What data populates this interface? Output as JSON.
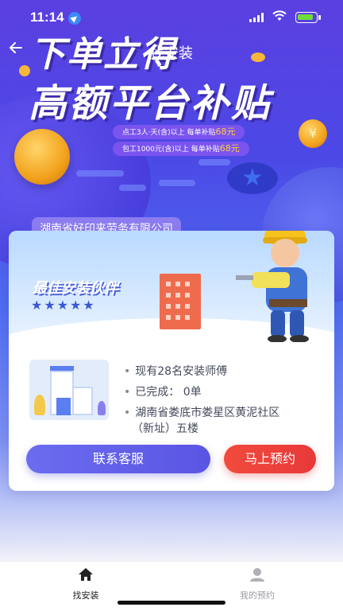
{
  "status_bar": {
    "time": "11:14"
  },
  "nav": {
    "title": "找安装"
  },
  "hero": {
    "headline_line1": "下单立得",
    "headline_line2": "高额平台补贴",
    "promo1": {
      "text": "点工3人·天(含)以上  每单补贴",
      "amount": "68元"
    },
    "promo2": {
      "text": "包工1000元(含)以上  每单补贴",
      "amount": "68元"
    }
  },
  "company": {
    "name": "湖南省好印来劳务有限公司",
    "banner_label": "最佳安装伙伴",
    "stars": "★★★★★",
    "info": {
      "installers": "现有28名安装师傅",
      "completed": "已完成： 0单",
      "address_line1": "湖南省娄底市娄星区黄泥社区",
      "address_line2": "（新址）五楼"
    },
    "buttons": {
      "contact": "联系客服",
      "book": "马上预约"
    }
  },
  "tabs": [
    {
      "label": "找安装",
      "icon": "home-icon",
      "active": true
    },
    {
      "label": "我的预约",
      "icon": "user-icon",
      "active": false
    }
  ],
  "colors": {
    "primary": "#5a55e3",
    "book": "#e8393a",
    "promo_amount": "#ffd13a"
  }
}
